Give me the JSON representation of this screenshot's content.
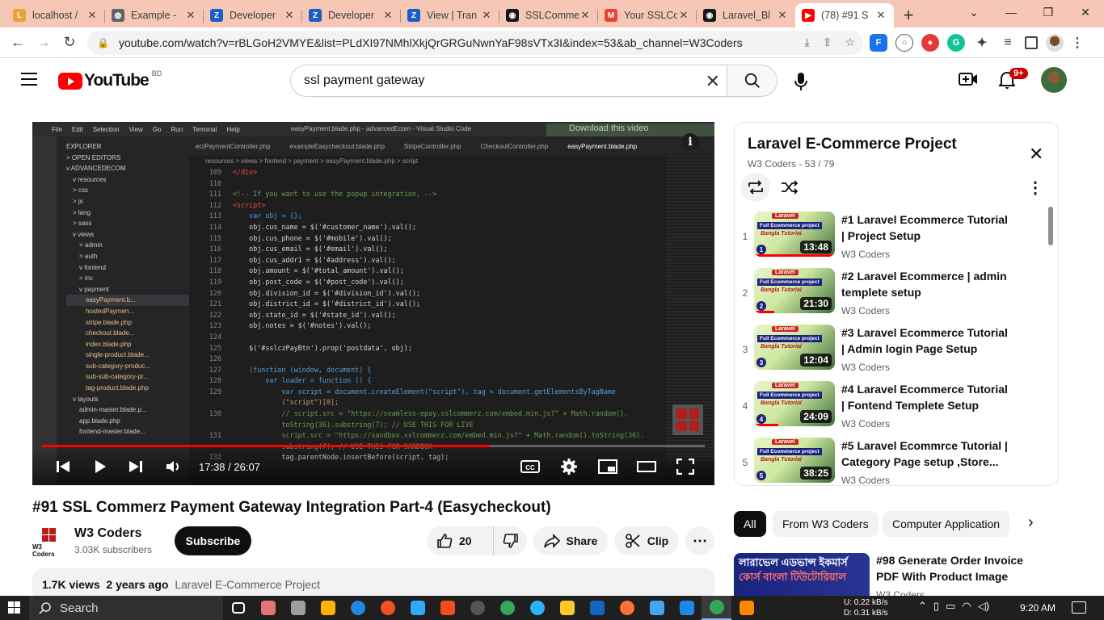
{
  "browser": {
    "tabs": [
      {
        "title": "localhost /",
        "color": "#e8a43a",
        "glyph": "L"
      },
      {
        "title": "Example -",
        "color": "#5f6368",
        "glyph": "◍"
      },
      {
        "title": "Developer",
        "color": "#1a5dc8",
        "glyph": "Z"
      },
      {
        "title": "Developer",
        "color": "#1a5dc8",
        "glyph": "Z"
      },
      {
        "title": "View | Tran",
        "color": "#1a5dc8",
        "glyph": "Z"
      },
      {
        "title": "SSLComme",
        "color": "#181717",
        "glyph": "◉"
      },
      {
        "title": "Your SSLCo",
        "color": "#ea4335",
        "glyph": "M"
      },
      {
        "title": "Laravel_Bl",
        "color": "#181717",
        "glyph": "◉"
      },
      {
        "title": "(78) #91 S",
        "color": "#ff0000",
        "glyph": "▶"
      }
    ],
    "new_tab": "+",
    "url": "youtube.com/watch?v=rBLGoH2VMYE&list=PLdXI97NMhlXkjQrGRGuNwnYaF98sVTx3I&index=53&ab_channel=W3Coders"
  },
  "youtube": {
    "logo_text": "YouTube",
    "country": "BD",
    "search_value": "ssl payment gateway",
    "notif_count": "9+"
  },
  "video": {
    "title": "#91 SSL Commerz Payment Gateway Integration Part-4 (Easycheckout)",
    "current_time": "17:38 / 26:07",
    "progress": 0.675,
    "download_overlay": "Download this video",
    "editor": {
      "title": "easyPayment.blade.php - advancedEcom - Visual Studio Code",
      "menu": [
        "File",
        "Edit",
        "Selection",
        "View",
        "Go",
        "Run",
        "Terminal",
        "Help"
      ],
      "tabs": [
        "erzPaymentController.php",
        "exampleEasycheckout.blade.php",
        "StripeController.php",
        "CheckoutController.php",
        "easyPayment.blade.php"
      ],
      "breadcrumb": "resources > views > fontend > payment > easyPayment.blade.php > script",
      "explorer": [
        "EXPLORER",
        "> OPEN EDITORS",
        "v ADVANCEDECOM",
        "v resources",
        "> css",
        "> js",
        "> lang",
        "> sass",
        "v views",
        "> admin",
        "> auth",
        "v fontend",
        "> inc",
        "v payment",
        "easyPayment.b...",
        "hostedPaymen...",
        "stripe.blade.php",
        "checkout.blade...",
        "index.blade.php",
        "single-product.blade...",
        "sub-category-produc...",
        "sub-sub-category-pr...",
        "tag-product.blade.php",
        "v layouts",
        "admin-master.blade.p...",
        "app.blade.php",
        "fontend-master.blade..."
      ]
    },
    "code_lines": [
      {
        "n": "109",
        "t": "</div>"
      },
      {
        "n": "110",
        "t": ""
      },
      {
        "n": "111",
        "t": "<!-- If you want to use the popup integration, -->"
      },
      {
        "n": "112",
        "t": "<script>"
      },
      {
        "n": "113",
        "t": "    var obj = {};"
      },
      {
        "n": "114",
        "t": "    obj.cus_name = $('#customer_name').val();"
      },
      {
        "n": "115",
        "t": "    obj.cus_phone = $('#mobile').val();"
      },
      {
        "n": "116",
        "t": "    obj.cus_email = $('#email').val();"
      },
      {
        "n": "117",
        "t": "    obj.cus_addr1 = $('#address').val();"
      },
      {
        "n": "118",
        "t": "    obj.amount = $('#total_amount').val();"
      },
      {
        "n": "119",
        "t": "    obj.post_code = $('#post_code').val();"
      },
      {
        "n": "120",
        "t": "    obj.division_id = $('#division_id').val();"
      },
      {
        "n": "121",
        "t": "    obj.district_id = $('#district_id').val();"
      },
      {
        "n": "122",
        "t": "    obj.state_id = $('#state_id').val();"
      },
      {
        "n": "123",
        "t": "    obj.notes = $('#notes').val();"
      },
      {
        "n": "124",
        "t": ""
      },
      {
        "n": "125",
        "t": "    $('#sslczPayBtn').prop('postdata', obj);"
      },
      {
        "n": "126",
        "t": ""
      },
      {
        "n": "127",
        "t": "    (function (window, document) {"
      },
      {
        "n": "128",
        "t": "        var loader = function () {"
      },
      {
        "n": "129",
        "t": "            var script = document.createElement(\"script\"), tag = document.getElementsByTagName"
      },
      {
        "n": "",
        "t": "            (\"script\")[0];"
      },
      {
        "n": "130",
        "t": "            // script.src = \"https://seamless-epay.sslcommerz.com/embed.min.js?\" + Math.random()."
      },
      {
        "n": "",
        "t": "            toString(36).substring(7); // USE THIS FOR LIVE"
      },
      {
        "n": "131",
        "t": "            script.src = \"https://sandbox.sslcommerz.com/embed.min.js?\" + Math.random().toString(36)."
      },
      {
        "n": "",
        "t": "            substring(7); // USE THIS FOR SANDBOX"
      },
      {
        "n": "132",
        "t": "            tag.parentNode.insertBefore(script, tag);"
      }
    ]
  },
  "channel": {
    "name": "W3 Coders",
    "avatar_text": "W3 Coders",
    "subscribers": "3.03K subscribers",
    "subscribe_label": "Subscribe"
  },
  "actions": {
    "likes": "20",
    "share": "Share",
    "clip": "Clip"
  },
  "description": {
    "views": "1.7K views",
    "age": "2 years ago",
    "playlist": "Laravel E-Commerce Project"
  },
  "playlist": {
    "title": "Laravel E-Commerce Project",
    "subtitle": "W3 Coders - 53 / 79",
    "items": [
      {
        "idx": "1",
        "title": "#1 Laravel Ecommerce Tutorial | Project Setup",
        "channel": "W3 Coders",
        "duration": "13:48",
        "num": "1",
        "watched": 1.0
      },
      {
        "idx": "2",
        "title": "#2 Laravel Ecommerce | admin templete setup",
        "channel": "W3 Coders",
        "duration": "21:30",
        "num": "2",
        "watched": 0.25
      },
      {
        "idx": "3",
        "title": "#3 Laravel Ecommerce Tutorial | Admin login Page Setup",
        "channel": "W3 Coders",
        "duration": "12:04",
        "num": "3",
        "watched": 0.0
      },
      {
        "idx": "4",
        "title": "#4 Laravel Ecommerce Tutorial | Fontend Templete Setup",
        "channel": "W3 Coders",
        "duration": "24:09",
        "num": "4",
        "watched": 0.3
      },
      {
        "idx": "5",
        "title": "#5 Laravel Ecommrce Tutorial | Category Page setup ,Store...",
        "channel": "W3 Coders",
        "duration": "38:25",
        "num": "5",
        "watched": 0.0
      }
    ],
    "thumb_badge": "Laravel",
    "thumb_line1": "Full Ecommerce project",
    "thumb_line2": "Bangla Tutorial"
  },
  "chips": [
    "All",
    "From W3 Coders",
    "Computer Application"
  ],
  "recommendation": {
    "title": "#98 Generate Order Invoice PDF With Product Image",
    "channel": "W3 Coders",
    "thumb_line1": "লারাভেল এডভান্স ইকমার্স",
    "thumb_line2": "কোর্স বাংলা টিউটোরিয়াল"
  },
  "taskbar": {
    "search": "Search",
    "net_up": "U:      0.22 kB/s",
    "net_down": "D:      0.31 kB/s",
    "time": "9:20 AM",
    "apps": [
      {
        "name": "task-view",
        "color": "#ffffff"
      },
      {
        "name": "paint",
        "color": "#e57373"
      },
      {
        "name": "settings",
        "color": "#9e9e9e"
      },
      {
        "name": "store",
        "color": "#ffb300"
      },
      {
        "name": "edge",
        "color": "#1e88e5"
      },
      {
        "name": "git",
        "color": "#f4511e"
      },
      {
        "name": "photoshop",
        "color": "#31a8ff"
      },
      {
        "name": "figma",
        "color": "#f24e1e"
      },
      {
        "name": "obs",
        "color": "#555555"
      },
      {
        "name": "chrome",
        "color": "#34a853"
      },
      {
        "name": "telegram",
        "color": "#29b6f6"
      },
      {
        "name": "explorer",
        "color": "#ffca28"
      },
      {
        "name": "mail",
        "color": "#1565c0"
      },
      {
        "name": "firefox",
        "color": "#ff7139"
      },
      {
        "name": "onedrive",
        "color": "#42a5f5"
      },
      {
        "name": "vscode",
        "color": "#1e88e5"
      },
      {
        "name": "chrome-active",
        "color": "#34a853"
      },
      {
        "name": "vlc",
        "color": "#ff8800"
      }
    ]
  }
}
